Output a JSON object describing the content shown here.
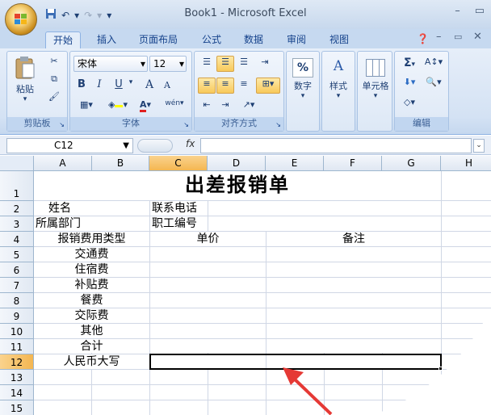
{
  "window": {
    "title": "Book1 - Microsoft Excel"
  },
  "qat": {
    "undo": "↶",
    "redo": "↷",
    "customize": "▾"
  },
  "tabs": [
    {
      "label": "开始",
      "active": true
    },
    {
      "label": "插入"
    },
    {
      "label": "页面布局"
    },
    {
      "label": "公式"
    },
    {
      "label": "数据"
    },
    {
      "label": "审阅"
    },
    {
      "label": "视图"
    }
  ],
  "ribbon": {
    "clipboard": {
      "label": "剪贴板",
      "paste": "粘贴"
    },
    "font": {
      "label": "字体",
      "name": "宋体",
      "size": "12",
      "bold": "B",
      "italic": "I",
      "underline": "U",
      "grow": "A",
      "shrink": "A",
      "fontcolor": "A",
      "phonetic": "wén"
    },
    "alignment": {
      "label": "对齐方式"
    },
    "number": {
      "label": "数字",
      "symbol": "%"
    },
    "styles": {
      "label": "样式"
    },
    "cells": {
      "label": "单元格"
    },
    "editing": {
      "label": "编辑",
      "sum": "Σ"
    }
  },
  "formula_bar": {
    "name_box": "C12",
    "fx": "fx",
    "value": ""
  },
  "sheet": {
    "columns": [
      "A",
      "B",
      "C",
      "D",
      "E",
      "F",
      "G",
      "H"
    ],
    "selected_column": "C",
    "rows": [
      "1",
      "2",
      "3",
      "4",
      "5",
      "6",
      "7",
      "8",
      "9",
      "10",
      "11",
      "12",
      "13",
      "14",
      "15"
    ],
    "selected_row": "12",
    "cells": {
      "title": "出差报销单",
      "a2": "姓名",
      "c2": "联系电话",
      "a3": "所属部门",
      "c3": "职工编号",
      "a4": "报销费用类型",
      "c4": "单价",
      "e4": "备注",
      "b5": "交通费",
      "b6": "住宿费",
      "b7": "补贴费",
      "b8": "餐费",
      "b9": "交际费",
      "b10": "其他",
      "b11": "合计",
      "a12": "人民币大写"
    }
  },
  "colors": {
    "accent": "#f4b651",
    "arrow": "#e53935",
    "ribbon": "#d4e2f4"
  }
}
